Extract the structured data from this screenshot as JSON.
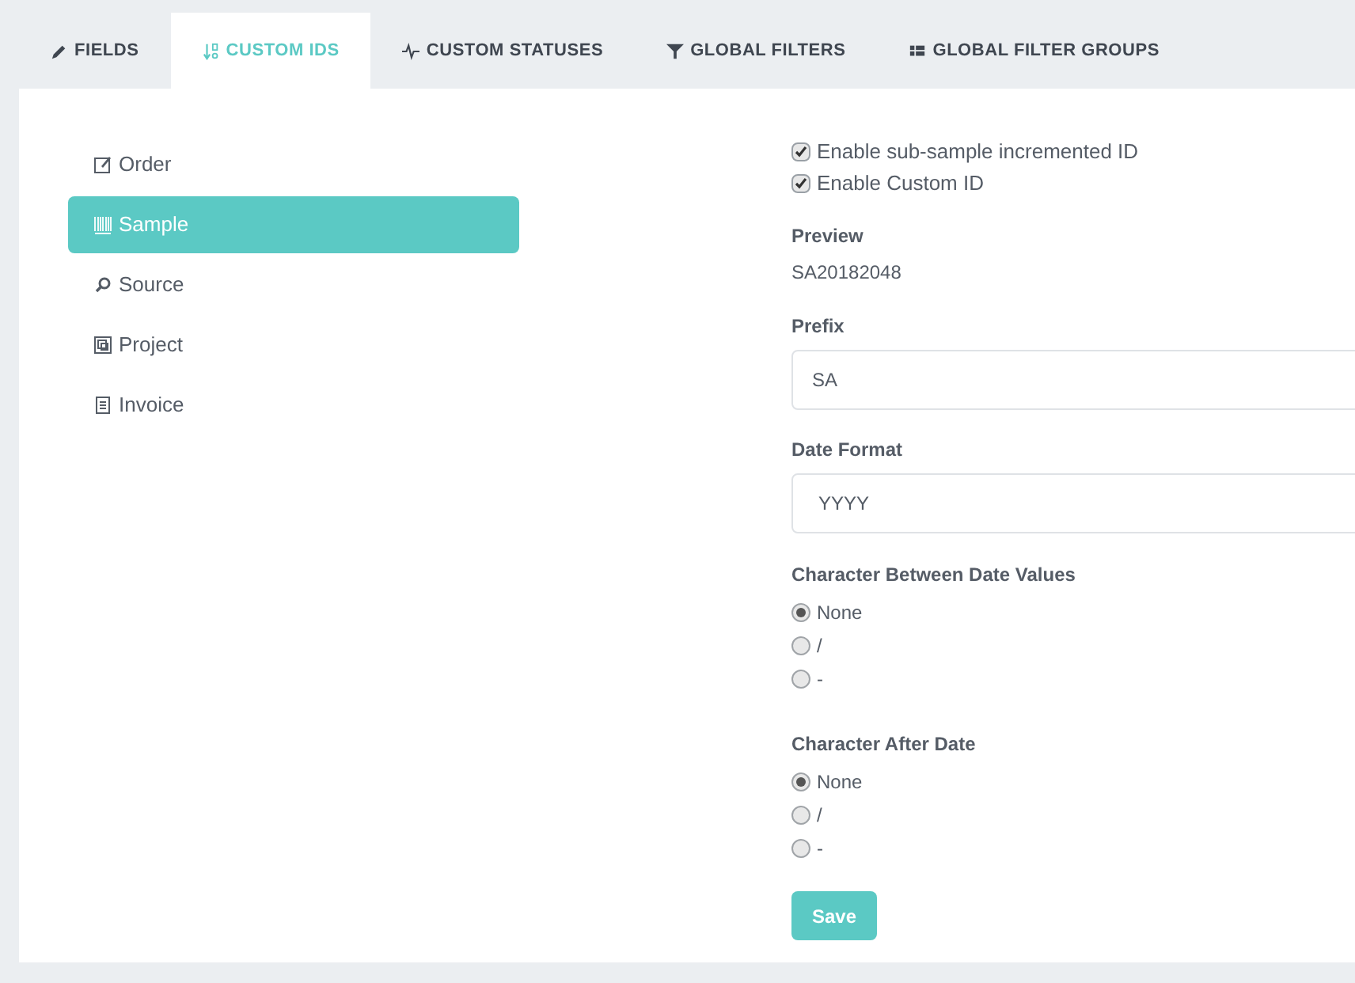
{
  "tabs": [
    {
      "label": "FIELDS",
      "kind": "pencil",
      "selected": false
    },
    {
      "label": "CUSTOM IDS",
      "kind": "sort",
      "selected": true
    },
    {
      "label": "CUSTOM STATUSES",
      "kind": "pulse",
      "selected": false
    },
    {
      "label": "GLOBAL FILTERS",
      "kind": "filter",
      "selected": false
    },
    {
      "label": "GLOBAL FILTER GROUPS",
      "kind": "grid",
      "selected": false
    }
  ],
  "sidebar": {
    "items": [
      {
        "label": "Order",
        "kind": "edit",
        "selected": false
      },
      {
        "label": "Sample",
        "kind": "barcode",
        "selected": true
      },
      {
        "label": "Source",
        "kind": "search",
        "selected": false
      },
      {
        "label": "Project",
        "kind": "frame",
        "selected": false
      },
      {
        "label": "Invoice",
        "kind": "receipt",
        "selected": false
      }
    ]
  },
  "options": [
    {
      "label": "Enable sub-sample incremented ID",
      "checked": true
    },
    {
      "label": "Enable Custom ID",
      "checked": true
    }
  ],
  "preview": {
    "label": "Preview",
    "value": "SA20182048"
  },
  "fields": [
    {
      "label": "Prefix",
      "value": "SA"
    },
    {
      "label": "Date Format",
      "value": "YYYY"
    }
  ],
  "radio_groups": [
    {
      "label": "Character Between Date Values",
      "options": [
        {
          "label": "None",
          "selected": true
        },
        {
          "label": "/",
          "selected": false
        },
        {
          "label": "-",
          "selected": false
        }
      ]
    },
    {
      "label": "Character After Date",
      "options": [
        {
          "label": "None",
          "selected": true
        },
        {
          "label": "/",
          "selected": false
        },
        {
          "label": "-",
          "selected": false
        }
      ]
    }
  ],
  "save_button": "Save"
}
